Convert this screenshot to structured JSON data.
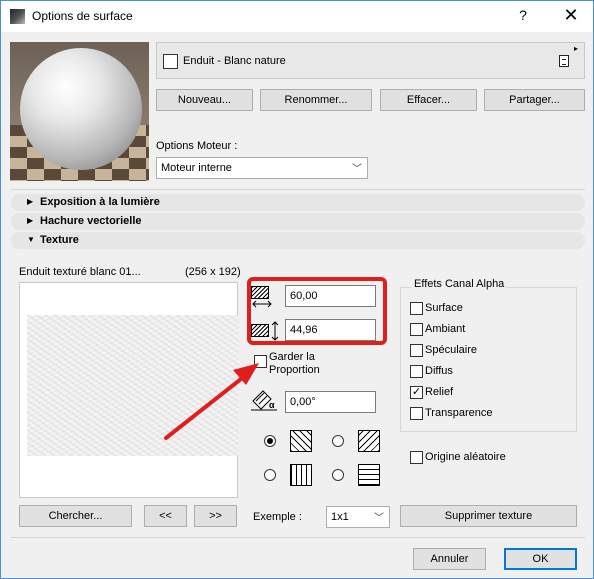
{
  "window": {
    "title": "Options de surface",
    "help_label": "?",
    "close_label": "✕"
  },
  "material": {
    "name": "Enduit - Blanc nature",
    "flyout_glyph": "▸"
  },
  "actions": {
    "new": "Nouveau...",
    "rename": "Renommer...",
    "delete": "Effacer...",
    "share": "Partager..."
  },
  "engine": {
    "label": "Options Moteur :",
    "value": "Moteur interne"
  },
  "sections": {
    "exposure": "Exposition à la lumière",
    "hatch": "Hachure vectorielle",
    "texture": "Texture"
  },
  "texture": {
    "name": "Enduit texturé blanc 01...",
    "size": "(256 x 192)",
    "width": "60,00",
    "height": "44,96",
    "keep_ratio": "Garder la Proportion",
    "angle": "0,00°",
    "angle_icon_label": "α",
    "search": "Chercher...",
    "prev": "<<",
    "next": ">>",
    "example_label": "Exemple :",
    "example_value": "1x1",
    "remove": "Supprimer texture"
  },
  "alpha": {
    "title": "Effets Canal Alpha",
    "options": [
      {
        "label": "Surface",
        "checked": false
      },
      {
        "label": "Ambiant",
        "checked": false
      },
      {
        "label": "Spéculaire",
        "checked": false
      },
      {
        "label": "Diffus",
        "checked": false
      },
      {
        "label": "Relief",
        "checked": true
      },
      {
        "label": "Transparence",
        "checked": false
      }
    ],
    "random_origin": "Origine aléatoire"
  },
  "footer": {
    "cancel": "Annuler",
    "ok": "OK"
  },
  "colors": {
    "highlight": "#e01e1e",
    "accent": "#0078d7"
  },
  "icons": [
    "app-icon",
    "help-icon",
    "close-icon",
    "chevron-down-icon",
    "triangle-right-icon",
    "triangle-down-icon",
    "width-icon",
    "height-icon",
    "angle-icon",
    "check-icon",
    "pointer-arrow-icon"
  ]
}
